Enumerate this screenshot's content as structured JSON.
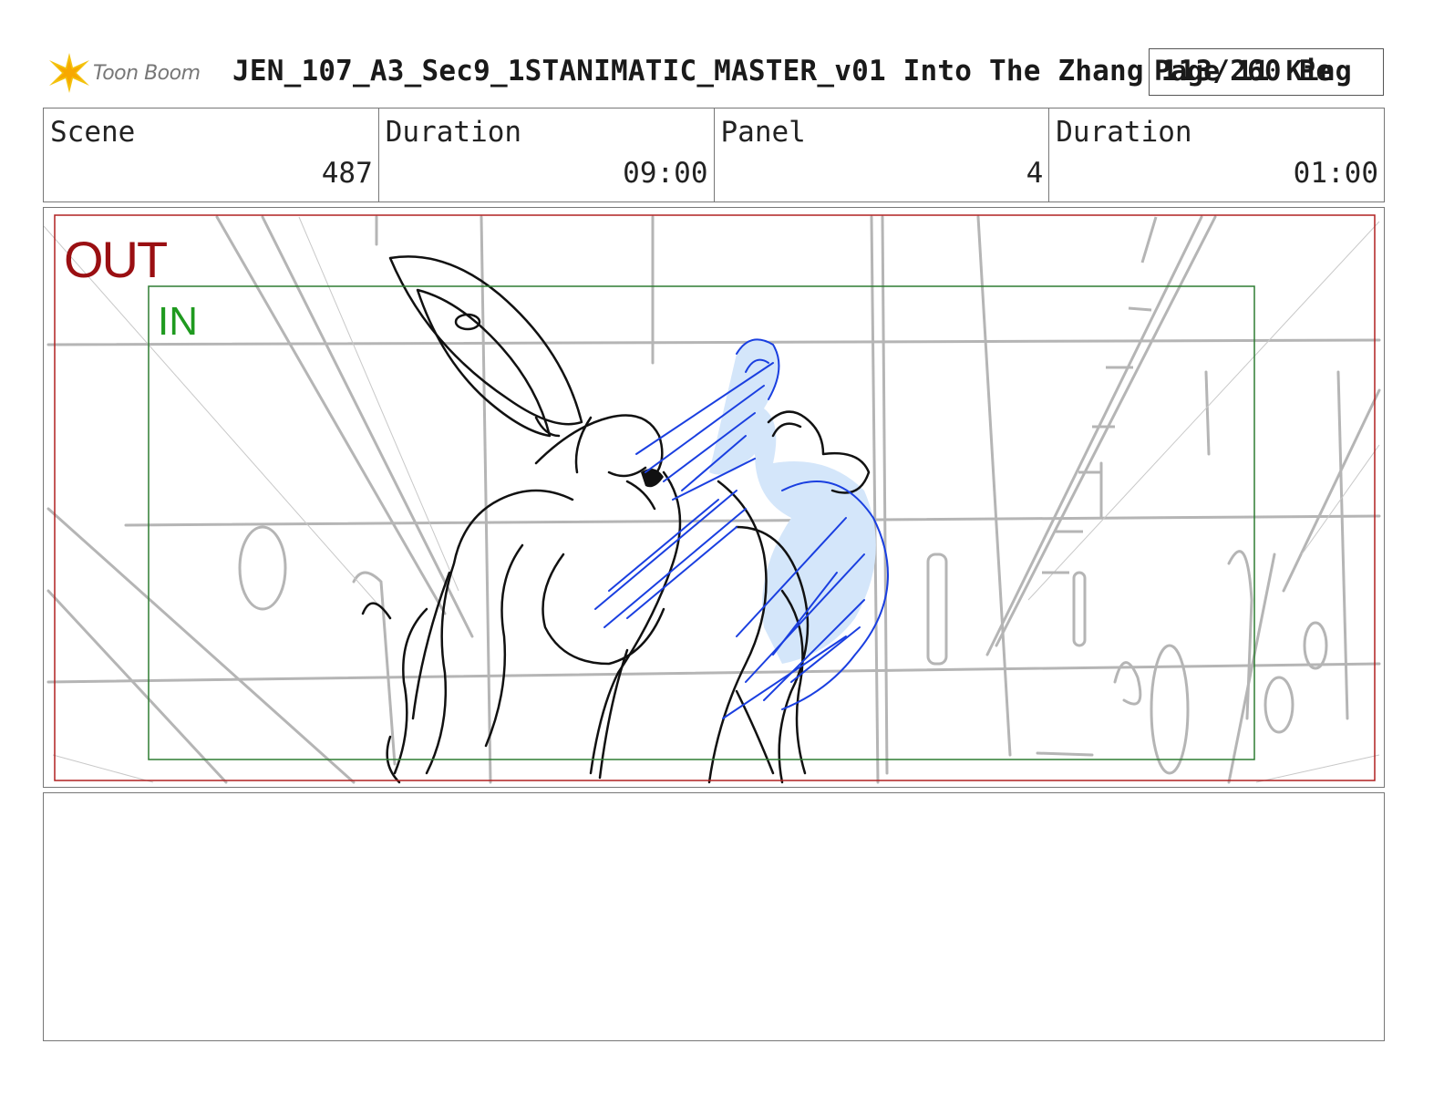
{
  "header": {
    "logo_text": "Toon Boom",
    "title": "JEN_107_A3_Sec9_1STANIMATIC_MASTER_v01  Into The Zhang 113/260 Pe",
    "page_label": "Page 11 King"
  },
  "info": {
    "scene_label": "Scene",
    "scene_value": "487",
    "scene_duration_label": "Duration",
    "scene_duration_value": "09:00",
    "panel_label": "Panel",
    "panel_value": "4",
    "panel_duration_label": "Duration",
    "panel_duration_value": "01:00"
  },
  "panel": {
    "out_label": "OUT",
    "in_label": "IN"
  },
  "colors": {
    "out_frame": "#b02020",
    "in_frame": "#2e7d32",
    "sketch_gray": "#b5b5b5",
    "ink_black": "#111111",
    "fx_blue": "#1a3fe0",
    "fx_fill": "#d4e6fa"
  },
  "notes": {}
}
